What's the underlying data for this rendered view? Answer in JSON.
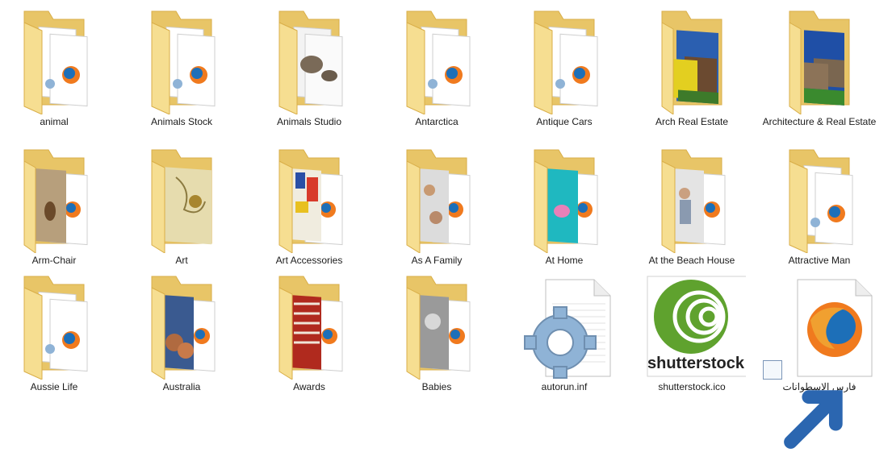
{
  "colors": {
    "folder_back": "#E8C567",
    "folder_front": "#F6DE91",
    "folder_edge": "#D9AE48",
    "shutterstock_green": "#5FA22E",
    "gear_blue": "#8FB3D6",
    "firefox_orange": "#F07A1E",
    "firefox_blue": "#1D6FB8",
    "label_text": "#1B1B1B",
    "background": "#FFFFFF"
  },
  "files": [
    {
      "name": "animal",
      "type": "folder",
      "preview": "doc-firefox"
    },
    {
      "name": "Animals Stock",
      "type": "folder",
      "preview": "doc-firefox"
    },
    {
      "name": "Animals Studio",
      "type": "folder",
      "preview": "turtle-photo"
    },
    {
      "name": "Antarctica",
      "type": "folder",
      "preview": "doc-firefox"
    },
    {
      "name": "Antique Cars",
      "type": "folder",
      "preview": "doc-firefox"
    },
    {
      "name": "Arch Real Estate",
      "type": "folder",
      "preview": "house-photo"
    },
    {
      "name": "Architecture & Real Estate",
      "type": "folder",
      "preview": "mansion-photo"
    },
    {
      "name": "Arm-Chair",
      "type": "folder",
      "preview": "chair-photo"
    },
    {
      "name": "Art",
      "type": "folder",
      "preview": "art-photo"
    },
    {
      "name": "Art Accessories",
      "type": "folder",
      "preview": "art-accessories-photo"
    },
    {
      "name": "As A Family",
      "type": "folder",
      "preview": "family-photo"
    },
    {
      "name": "At Home",
      "type": "folder",
      "preview": "home-photo"
    },
    {
      "name": "At the Beach House",
      "type": "folder",
      "preview": "beach-photo"
    },
    {
      "name": "Attractive Man",
      "type": "folder",
      "preview": "doc-firefox"
    },
    {
      "name": "Aussie Life",
      "type": "folder",
      "preview": "doc-firefox"
    },
    {
      "name": "Australia",
      "type": "folder",
      "preview": "rocks-photo"
    },
    {
      "name": "Awards",
      "type": "folder",
      "preview": "stairs-photo"
    },
    {
      "name": "Babies",
      "type": "folder",
      "preview": "baby-photo"
    },
    {
      "name": "autorun.inf",
      "type": "settings-file",
      "icon": "gear-document-icon"
    },
    {
      "name": "shutterstock.ico",
      "type": "icon-file",
      "icon": "shutterstock-logo-icon",
      "logo_text": "shutterstock"
    },
    {
      "name": "فارس الاسطوانات",
      "type": "shortcut",
      "icon": "firefox-document-icon"
    }
  ]
}
